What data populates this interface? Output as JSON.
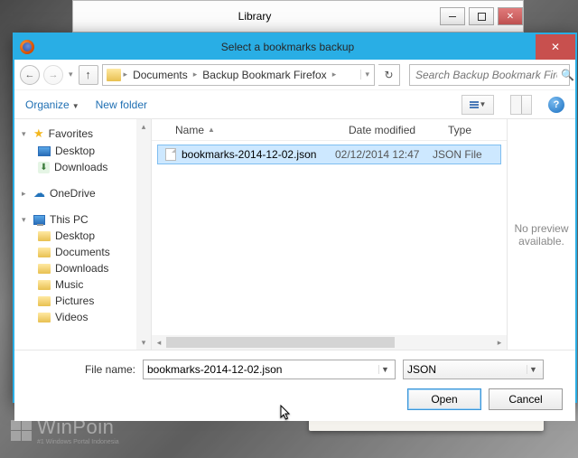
{
  "library_window": {
    "title": "Library"
  },
  "dialog": {
    "title": "Select a bookmarks backup",
    "breadcrumb": [
      "Documents",
      "Backup Bookmark Firefox"
    ],
    "search_placeholder": "Search Backup Bookmark Fire...",
    "toolbar": {
      "organize": "Organize",
      "new_folder": "New folder"
    },
    "tree": {
      "favorites": {
        "label": "Favorites",
        "desktop": "Desktop",
        "downloads": "Downloads"
      },
      "onedrive": {
        "label": "OneDrive"
      },
      "thispc": {
        "label": "This PC",
        "desktop": "Desktop",
        "documents": "Documents",
        "downloads": "Downloads",
        "music": "Music",
        "pictures": "Pictures",
        "videos": "Videos"
      }
    },
    "columns": {
      "name": "Name",
      "date": "Date modified",
      "type": "Type"
    },
    "file": {
      "name": "bookmarks-2014-12-02.json",
      "date": "02/12/2014 12:47",
      "type": "JSON File"
    },
    "preview_text": "No preview available.",
    "filename_label": "File name:",
    "filename_value": "bookmarks-2014-12-02.json",
    "filter": "JSON",
    "open": "Open",
    "cancel": "Cancel"
  },
  "watermark": {
    "brand": "WinPoin",
    "tagline": "#1 Windows Portal Indonesia"
  }
}
